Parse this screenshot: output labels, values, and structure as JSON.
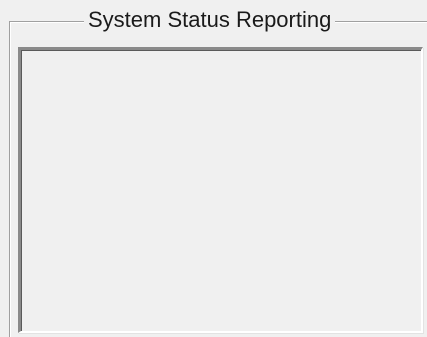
{
  "groupbox": {
    "title": "System Status Reporting"
  },
  "status_panel": {
    "lines": []
  },
  "colors": {
    "background": "#f0f0f0",
    "frame_shadow": "#a0a0a0",
    "panel_dark_edge": "#8a8a8a",
    "panel_light_edge": "#ffffff"
  }
}
